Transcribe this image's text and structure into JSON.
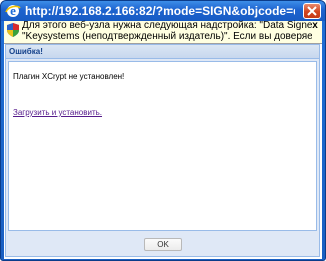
{
  "window": {
    "title": "http://192.168.2.166:82/?mode=SIGN&objcode=documen...",
    "icon": "ie-icon",
    "close_icon": "close-icon"
  },
  "infobar": {
    "icon": "shield-icon",
    "text_line1": "Для этого веб-узла нужна следующая надстройка: \"Data Signer\" от",
    "text_line2": "\"Keysystems (неподтвержденный издатель)\". Если вы доверяете этому...",
    "close_glyph": "x"
  },
  "dialog": {
    "title": "Ошибка!",
    "message": "Плагин XCrypt не установлен!",
    "link_label": "Загрузить и установить.",
    "ok_label": "OK"
  },
  "colors": {
    "titlebar": "#1d63cf",
    "infobar_bg": "#ffffe1",
    "panel_border": "#99bbe8",
    "panel_title": "#15428b",
    "link_visited": "#551a8b"
  }
}
